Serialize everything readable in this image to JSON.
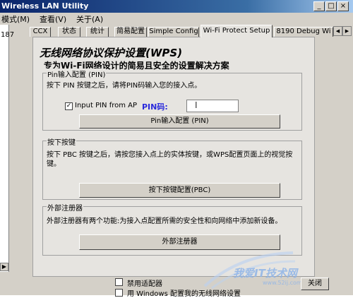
{
  "window": {
    "title": "Wireless LAN Utility"
  },
  "caption_buttons": {
    "minimize": "_",
    "maximize": "□",
    "close": "×"
  },
  "menu": {
    "items": [
      "模式(M)",
      "查看(V)",
      "关于(A)"
    ]
  },
  "left_strip": {
    "text": "187",
    "scroll_arrow": "▶"
  },
  "tabs": [
    {
      "label": "CCX"
    },
    {
      "label": "状态"
    },
    {
      "label": "统计"
    },
    {
      "label": "简易配置"
    },
    {
      "label": "Simple Config"
    },
    {
      "label": "Wi-Fi Protect Setup",
      "active": true
    },
    {
      "label": "8190 Debug Wi"
    }
  ],
  "tab_scroll": {
    "left": "◀",
    "right": "▶"
  },
  "panel": {
    "title": "无线网络协议保护设置(WPS)",
    "subtitle": "专为Wi-Fi网络设计的简易且安全的设置解决方案"
  },
  "pin_group": {
    "label": "Pin输入配置 (PIN)",
    "description": "按下 PIN 按键之后，请将PIN码输入您的接入点。",
    "checkbox_label": "Input PIN from AP",
    "checkbox_checked": true,
    "checkbox_mark": "✓",
    "pin_label": "PIN码:",
    "pin_value": "",
    "cursor_glyph": "I",
    "button_label": "Pin输入配置 (PIN)"
  },
  "pbc_group": {
    "label": "按下按键",
    "description_line1": "按下 PBC 按键之后，请按您接入点上的实体按键，或WPS配置页面上的视觉按",
    "description_line2": "键。",
    "button_label": "按下按键配置(PBC)"
  },
  "registrar_group": {
    "label": "外部注册器",
    "description": "外部注册器有两个功能:为接入点配置所需的安全性和向网络中添加新设备。",
    "button_label": "外部注册器"
  },
  "bottom": {
    "disable_adapter_label": "禁用适配器",
    "windows_config_label": "用 Windows 配置我的无线网络设置",
    "button_label": "关闭"
  },
  "watermark": {
    "text": "我爱IT技术网",
    "subtext": "www.52ij.com"
  },
  "colors": {
    "titlebar": "#0a246a",
    "window_bg": "#d4d0c8",
    "pin_label": "#2b2bdc"
  }
}
